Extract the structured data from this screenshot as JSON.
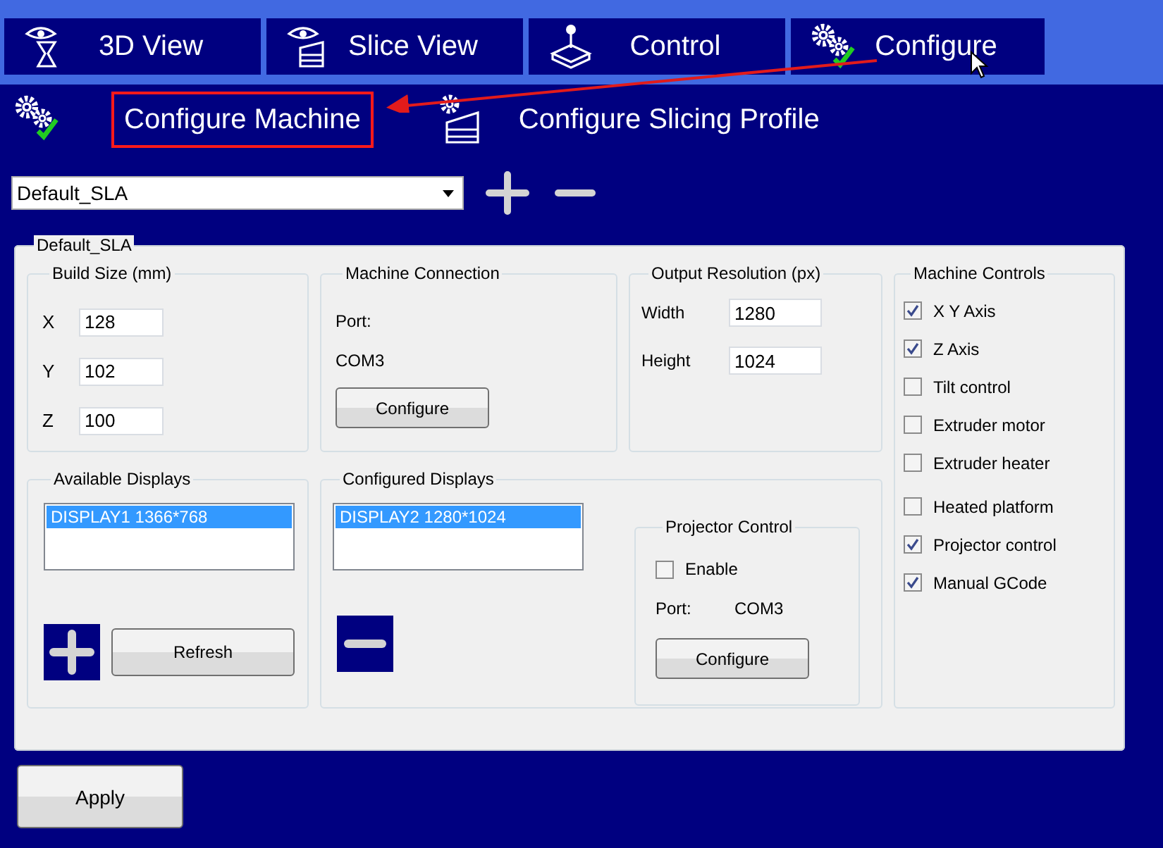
{
  "top_tabs": [
    {
      "label": "3D View",
      "kind": "model"
    },
    {
      "label": "Slice View",
      "kind": "slices"
    },
    {
      "label": "Control",
      "kind": "control"
    },
    {
      "label": "Configure",
      "kind": "settings"
    }
  ],
  "sub_tabs": [
    {
      "label": "Configure Machine",
      "kind": "machine",
      "annotated": true
    },
    {
      "label": "Configure Slicing Profile",
      "kind": "profile",
      "annotated": false
    }
  ],
  "profile_dropdown": {
    "value": "Default_SLA"
  },
  "panel": {
    "title": "Default_SLA",
    "build_size": {
      "title": "Build Size (mm)",
      "fields": [
        {
          "label": "X",
          "value": "128"
        },
        {
          "label": "Y",
          "value": "102"
        },
        {
          "label": "Z",
          "value": "100"
        }
      ]
    },
    "machine_connection": {
      "title": "Machine Connection",
      "port_label": "Port:",
      "port": "COM3",
      "button": "Configure"
    },
    "output_resolution": {
      "title": "Output Resolution (px)",
      "fields": [
        {
          "label": "Width",
          "value": "1280"
        },
        {
          "label": "Height",
          "value": "1024"
        }
      ]
    },
    "machine_controls": {
      "title": "Machine Controls",
      "items": [
        {
          "label": "X Y Axis",
          "checked": true
        },
        {
          "label": "Z Axis",
          "checked": true
        },
        {
          "label": "Tilt control",
          "checked": false
        },
        {
          "label": "Extruder motor",
          "checked": false
        },
        {
          "label": "Extruder heater",
          "checked": false
        },
        {
          "label": "Heated platform",
          "checked": false
        },
        {
          "label": "Projector control",
          "checked": true
        },
        {
          "label": "Manual GCode",
          "checked": true
        }
      ]
    },
    "available_displays": {
      "title": "Available Displays",
      "items": [
        {
          "label": "DISPLAY1 1366*768",
          "selected": true
        }
      ],
      "button": "Refresh"
    },
    "configured_displays": {
      "title": "Configured Displays",
      "items": [
        {
          "label": "DISPLAY2 1280*1024",
          "selected": true
        }
      ],
      "projector_control": {
        "title": "Projector Control",
        "enable": {
          "label": "Enable",
          "checked": false
        },
        "port_label": "Port:",
        "port": "COM3",
        "button": "Configure"
      }
    }
  },
  "apply_button": "Apply"
}
